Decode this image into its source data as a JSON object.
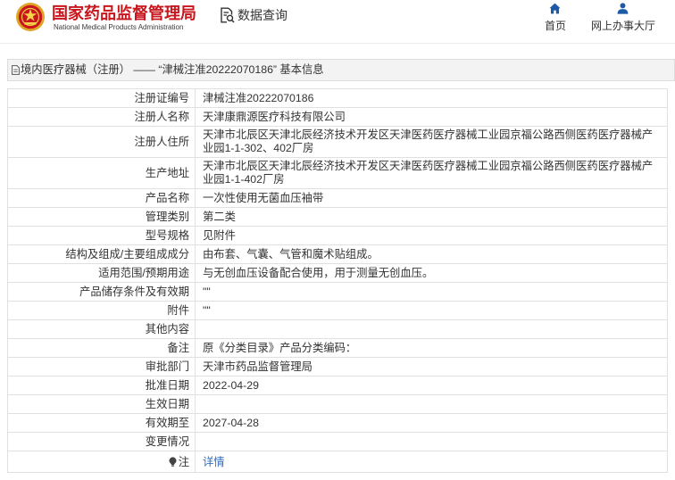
{
  "header": {
    "logo_icon": "national-emblem-logo",
    "agency_name_cn": "国家药品监督管理局",
    "agency_name_en": "National Medical Products Administration",
    "query": {
      "icon": "document-search-icon",
      "label": "数据查询"
    },
    "nav": [
      {
        "icon": "home-icon",
        "label": "首页"
      },
      {
        "icon": "user-icon",
        "label": "网上办事大厅"
      }
    ]
  },
  "panel": {
    "icon": "document-icon",
    "title": "境内医疗器械（注册） —— “津械注准20222070186” 基本信息"
  },
  "details": {
    "rows": [
      {
        "label": "注册证编号",
        "value": "津械注准20222070186"
      },
      {
        "label": "注册人名称",
        "value": "天津康鼎源医疗科技有限公司"
      },
      {
        "label": "注册人住所",
        "value": "天津市北辰区天津北辰经济技术开发区天津医药医疗器械工业园京福公路西侧医药医疗器械产业园1-1-302、402厂房"
      },
      {
        "label": "生产地址",
        "value": "天津市北辰区天津北辰经济技术开发区天津医药医疗器械工业园京福公路西侧医药医疗器械产业园1-1-402厂房"
      },
      {
        "label": "产品名称",
        "value": "一次性使用无菌血压袖带"
      },
      {
        "label": "管理类别",
        "value": "第二类"
      },
      {
        "label": "型号规格",
        "value": "见附件"
      },
      {
        "label": "结构及组成/主要组成成分",
        "value": "由布套、气囊、气管和魔术贴组成。"
      },
      {
        "label": "适用范围/预期用途",
        "value": "与无创血压设备配合使用，用于测量无创血压。"
      },
      {
        "label": "产品储存条件及有效期",
        "value": "\"\""
      },
      {
        "label": "附件",
        "value": "\"\""
      },
      {
        "label": "其他内容",
        "value": ""
      },
      {
        "label": "备注",
        "value": "原《分类目录》产品分类编码："
      },
      {
        "label": "审批部门",
        "value": "天津市药品监督管理局"
      },
      {
        "label": "批准日期",
        "value": "2022-04-29"
      },
      {
        "label": "生效日期",
        "value": ""
      },
      {
        "label": "有效期至",
        "value": "2027-04-28"
      },
      {
        "label": "变更情况",
        "value": ""
      }
    ],
    "note": {
      "icon": "lightbulb-icon",
      "label": "注",
      "link_text": "详情"
    }
  },
  "colors": {
    "brand_red": "#c8161d",
    "nav_icon_blue": "#1c5aa6",
    "link_blue": "#2e6cbf",
    "panel_bg": "#f3f3f3",
    "table_border": "#e0e0e0"
  }
}
